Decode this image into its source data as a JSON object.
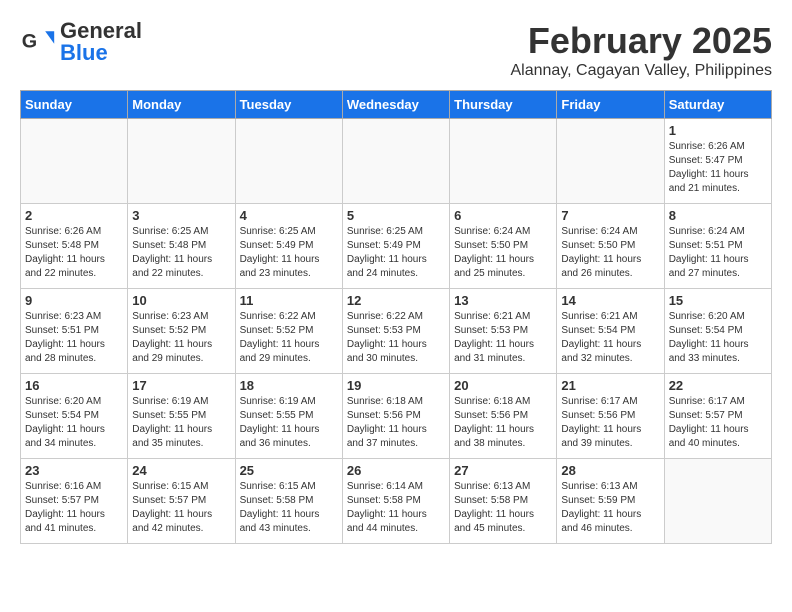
{
  "header": {
    "logo": {
      "general": "General",
      "blue": "Blue"
    },
    "title": "February 2025",
    "location": "Alannay, Cagayan Valley, Philippines"
  },
  "weekdays": [
    "Sunday",
    "Monday",
    "Tuesday",
    "Wednesday",
    "Thursday",
    "Friday",
    "Saturday"
  ],
  "weeks": [
    [
      {
        "day": "",
        "empty": true
      },
      {
        "day": "",
        "empty": true
      },
      {
        "day": "",
        "empty": true
      },
      {
        "day": "",
        "empty": true
      },
      {
        "day": "",
        "empty": true
      },
      {
        "day": "",
        "empty": true
      },
      {
        "day": "1",
        "sunrise": "6:26 AM",
        "sunset": "5:47 PM",
        "daylight": "11 hours and 21 minutes."
      }
    ],
    [
      {
        "day": "2",
        "sunrise": "6:26 AM",
        "sunset": "5:48 PM",
        "daylight": "11 hours and 22 minutes."
      },
      {
        "day": "3",
        "sunrise": "6:25 AM",
        "sunset": "5:48 PM",
        "daylight": "11 hours and 22 minutes."
      },
      {
        "day": "4",
        "sunrise": "6:25 AM",
        "sunset": "5:49 PM",
        "daylight": "11 hours and 23 minutes."
      },
      {
        "day": "5",
        "sunrise": "6:25 AM",
        "sunset": "5:49 PM",
        "daylight": "11 hours and 24 minutes."
      },
      {
        "day": "6",
        "sunrise": "6:24 AM",
        "sunset": "5:50 PM",
        "daylight": "11 hours and 25 minutes."
      },
      {
        "day": "7",
        "sunrise": "6:24 AM",
        "sunset": "5:50 PM",
        "daylight": "11 hours and 26 minutes."
      },
      {
        "day": "8",
        "sunrise": "6:24 AM",
        "sunset": "5:51 PM",
        "daylight": "11 hours and 27 minutes."
      }
    ],
    [
      {
        "day": "9",
        "sunrise": "6:23 AM",
        "sunset": "5:51 PM",
        "daylight": "11 hours and 28 minutes."
      },
      {
        "day": "10",
        "sunrise": "6:23 AM",
        "sunset": "5:52 PM",
        "daylight": "11 hours and 29 minutes."
      },
      {
        "day": "11",
        "sunrise": "6:22 AM",
        "sunset": "5:52 PM",
        "daylight": "11 hours and 29 minutes."
      },
      {
        "day": "12",
        "sunrise": "6:22 AM",
        "sunset": "5:53 PM",
        "daylight": "11 hours and 30 minutes."
      },
      {
        "day": "13",
        "sunrise": "6:21 AM",
        "sunset": "5:53 PM",
        "daylight": "11 hours and 31 minutes."
      },
      {
        "day": "14",
        "sunrise": "6:21 AM",
        "sunset": "5:54 PM",
        "daylight": "11 hours and 32 minutes."
      },
      {
        "day": "15",
        "sunrise": "6:20 AM",
        "sunset": "5:54 PM",
        "daylight": "11 hours and 33 minutes."
      }
    ],
    [
      {
        "day": "16",
        "sunrise": "6:20 AM",
        "sunset": "5:54 PM",
        "daylight": "11 hours and 34 minutes."
      },
      {
        "day": "17",
        "sunrise": "6:19 AM",
        "sunset": "5:55 PM",
        "daylight": "11 hours and 35 minutes."
      },
      {
        "day": "18",
        "sunrise": "6:19 AM",
        "sunset": "5:55 PM",
        "daylight": "11 hours and 36 minutes."
      },
      {
        "day": "19",
        "sunrise": "6:18 AM",
        "sunset": "5:56 PM",
        "daylight": "11 hours and 37 minutes."
      },
      {
        "day": "20",
        "sunrise": "6:18 AM",
        "sunset": "5:56 PM",
        "daylight": "11 hours and 38 minutes."
      },
      {
        "day": "21",
        "sunrise": "6:17 AM",
        "sunset": "5:56 PM",
        "daylight": "11 hours and 39 minutes."
      },
      {
        "day": "22",
        "sunrise": "6:17 AM",
        "sunset": "5:57 PM",
        "daylight": "11 hours and 40 minutes."
      }
    ],
    [
      {
        "day": "23",
        "sunrise": "6:16 AM",
        "sunset": "5:57 PM",
        "daylight": "11 hours and 41 minutes."
      },
      {
        "day": "24",
        "sunrise": "6:15 AM",
        "sunset": "5:57 PM",
        "daylight": "11 hours and 42 minutes."
      },
      {
        "day": "25",
        "sunrise": "6:15 AM",
        "sunset": "5:58 PM",
        "daylight": "11 hours and 43 minutes."
      },
      {
        "day": "26",
        "sunrise": "6:14 AM",
        "sunset": "5:58 PM",
        "daylight": "11 hours and 44 minutes."
      },
      {
        "day": "27",
        "sunrise": "6:13 AM",
        "sunset": "5:58 PM",
        "daylight": "11 hours and 45 minutes."
      },
      {
        "day": "28",
        "sunrise": "6:13 AM",
        "sunset": "5:59 PM",
        "daylight": "11 hours and 46 minutes."
      },
      {
        "day": "",
        "empty": true
      }
    ]
  ]
}
